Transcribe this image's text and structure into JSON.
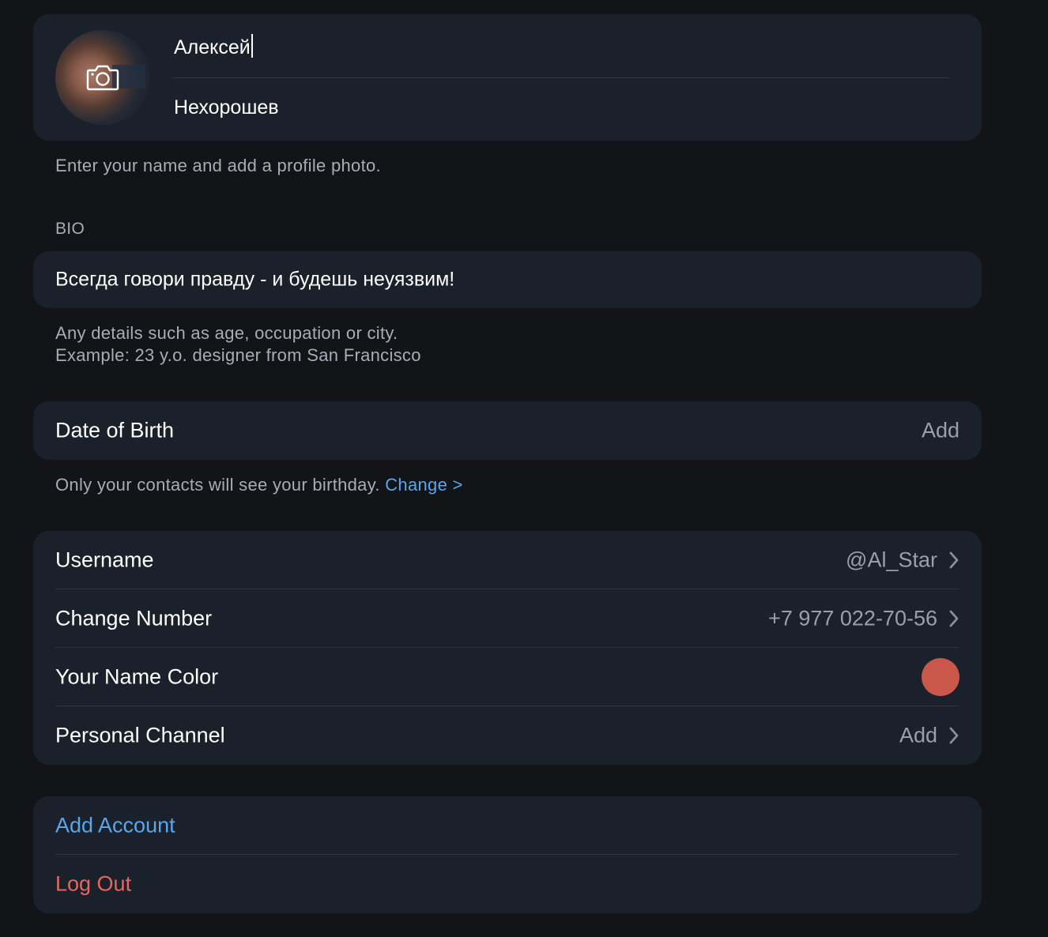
{
  "profile": {
    "first_name": "Алексей",
    "last_name": "Нехорошев",
    "name_hint": "Enter your name and add a profile photo."
  },
  "bio": {
    "header": "BIO",
    "text": "Всегда говори правду - и будешь неуязвим!",
    "hint_line1": "Any details such as age, occupation or city.",
    "hint_line2": "Example: 23 y.o. designer from San Francisco"
  },
  "birthday": {
    "label": "Date of Birth",
    "action": "Add",
    "hint": "Only your contacts will see your birthday.",
    "change_link": "Change >"
  },
  "account_rows": [
    {
      "label": "Username",
      "value": "@Al_Star"
    },
    {
      "label": "Change Number",
      "value": "+7 977 022-70-56"
    },
    {
      "label": "Your Name Color",
      "color": "#c9584b"
    },
    {
      "label": "Personal Channel",
      "value": "Add"
    }
  ],
  "actions": {
    "add_account": "Add Account",
    "log_out": "Log Out"
  },
  "colors": {
    "accent": "#5aa5ec",
    "danger": "#e5675d",
    "name_color": "#c9584b"
  },
  "icons": {
    "avatar_overlay": "camera-icon",
    "row_arrow": "chevron-right-icon"
  }
}
